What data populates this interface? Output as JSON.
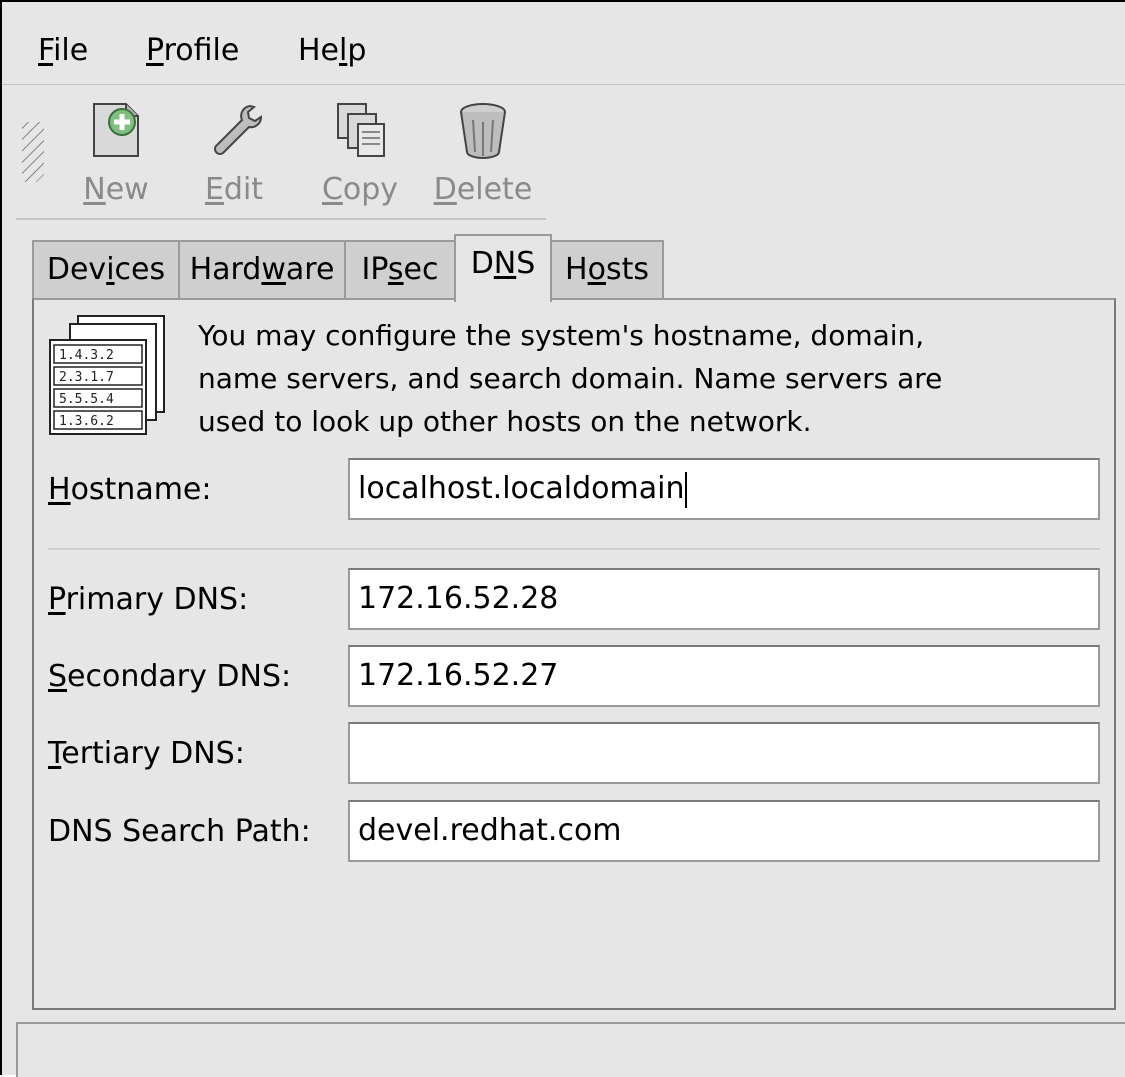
{
  "menu": {
    "file": {
      "accel": "F",
      "rest": "ile"
    },
    "profile": {
      "accel": "P",
      "rest": "rofile"
    },
    "help": {
      "pre": "He",
      "accel": "l",
      "rest": "p"
    }
  },
  "toolbar": {
    "new": {
      "accel": "N",
      "rest": "ew",
      "icon": "new-icon"
    },
    "edit": {
      "accel": "E",
      "rest": "dit",
      "icon": "wrench-icon"
    },
    "copy": {
      "accel": "C",
      "rest": "opy",
      "icon": "copy-icon"
    },
    "delete": {
      "accel": "D",
      "rest": "elete",
      "icon": "trash-icon"
    }
  },
  "tabs": [
    {
      "pre": "Dev",
      "accel": "i",
      "rest": "ces",
      "active": false
    },
    {
      "pre": "Hard",
      "accel": "w",
      "rest": "are",
      "active": false
    },
    {
      "pre": "IP",
      "accel": "s",
      "rest": "ec",
      "active": false
    },
    {
      "pre": "D",
      "accel": "N",
      "rest": "S",
      "active": true
    },
    {
      "pre": "H",
      "accel": "o",
      "rest": "sts",
      "active": false
    }
  ],
  "dns_panel": {
    "icon": "dns-list-icon",
    "icon_entries": [
      "1.4.3.2",
      "2.3.1.7",
      "5.5.5.4",
      "1.3.6.2"
    ],
    "description_lines": [
      "You may configure the system's hostname, domain,",
      "name servers, and search domain. Name servers are",
      "used to look up other hosts on the network."
    ],
    "hostname": {
      "accel": "H",
      "rest": "ostname:",
      "value": "localhost.localdomain"
    },
    "primary_dns": {
      "accel": "P",
      "rest": "rimary DNS:",
      "value": "172.16.52.28"
    },
    "secondary_dns": {
      "accel": "S",
      "rest": "econdary DNS:",
      "value": "172.16.52.27"
    },
    "tertiary_dns": {
      "accel": "T",
      "rest": "ertiary DNS:",
      "value": ""
    },
    "search_path": {
      "label": "DNS Search Path:",
      "value": "devel.redhat.com"
    }
  },
  "status_bar": {
    "text": ""
  }
}
